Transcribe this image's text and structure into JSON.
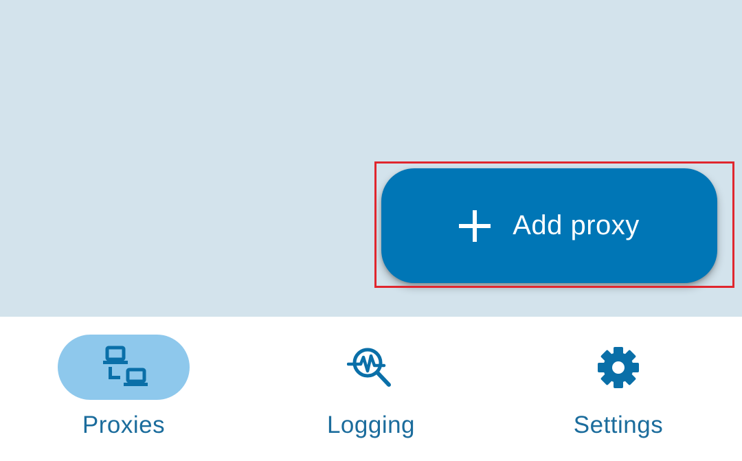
{
  "fab": {
    "label": "Add proxy",
    "icon": "plus-icon"
  },
  "bottom_nav": {
    "items": [
      {
        "label": "Proxies",
        "icon": "proxies-network-icon",
        "active": true
      },
      {
        "label": "Logging",
        "icon": "logging-search-icon",
        "active": false
      },
      {
        "label": "Settings",
        "icon": "gear-icon",
        "active": false
      }
    ]
  },
  "colors": {
    "content_background": "#d3e3ec",
    "fab_background": "#0076b6",
    "active_pill": "#8ec8ec",
    "nav_icon": "#0a6fa8",
    "nav_label": "#1b6c9c",
    "highlight": "#e0262e"
  }
}
